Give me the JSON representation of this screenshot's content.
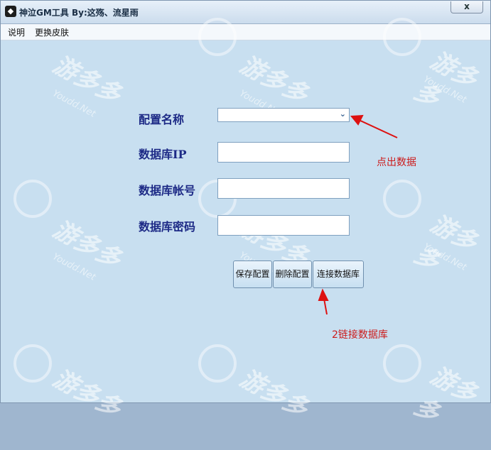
{
  "window": {
    "title": "神泣GM工具    By:这殇、流星雨",
    "close_glyph": "x",
    "app_icon_glyph": "🦅"
  },
  "menu": [
    "说明",
    "更换皮肤"
  ],
  "form": {
    "config_name_label": "配置名称",
    "db_ip_label": "数据库IP",
    "db_account_label": "数据库帐号",
    "db_password_label": "数据库密码",
    "config_name_value": "",
    "db_ip_value": "",
    "db_account_value": "",
    "db_password_value": ""
  },
  "buttons": {
    "save": "保存配置",
    "delete": "删除配置",
    "connect": "连接数据库"
  },
  "annotations": {
    "click_data": "点出数据",
    "connect_db": "2链接数据库",
    "color": "#cc1b1b"
  },
  "watermark": {
    "brand": "游多多",
    "site": "Youdd.Net"
  },
  "colors": {
    "background": "#c8dff0",
    "label": "#1d2a86",
    "annotation": "#cc1b1b"
  }
}
